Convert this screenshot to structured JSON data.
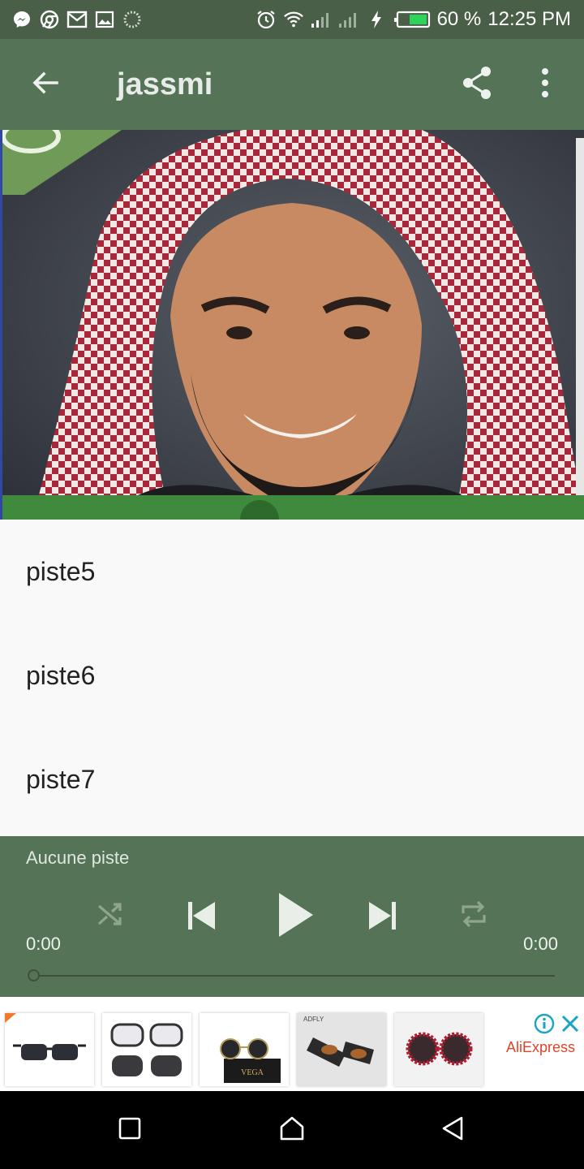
{
  "status_bar": {
    "battery": "60 %",
    "time": "12:25 PM",
    "icons": [
      "messenger-icon",
      "chrome-icon",
      "gmail-icon",
      "image-icon",
      "loading-icon",
      "alarm-icon",
      "wifi-icon",
      "signal-icon",
      "signal-icon-2",
      "charging-icon",
      "battery-icon"
    ]
  },
  "toolbar": {
    "title": "jassmi",
    "back_icon": "arrow-back-icon",
    "share_icon": "share-icon",
    "more_icon": "more-vert-icon"
  },
  "tracks": [
    "piste5",
    "piste6",
    "piste7"
  ],
  "player": {
    "now_playing": "Aucune piste",
    "time_current": "0:00",
    "time_total": "0:00",
    "progress": 0,
    "controls": [
      "shuffle-icon",
      "previous-icon",
      "play-icon",
      "next-icon",
      "repeat-icon"
    ]
  },
  "ad": {
    "brand": "AliExpress",
    "thumb_labels": [
      "VEGA",
      "ADFLY"
    ]
  },
  "nav_bar": [
    "recents-icon",
    "home-icon",
    "back-icon"
  ],
  "colors": {
    "status_bar": "#4a5f48",
    "toolbar": "#557357",
    "player": "#557357",
    "ad_brand": "#e0432b"
  }
}
